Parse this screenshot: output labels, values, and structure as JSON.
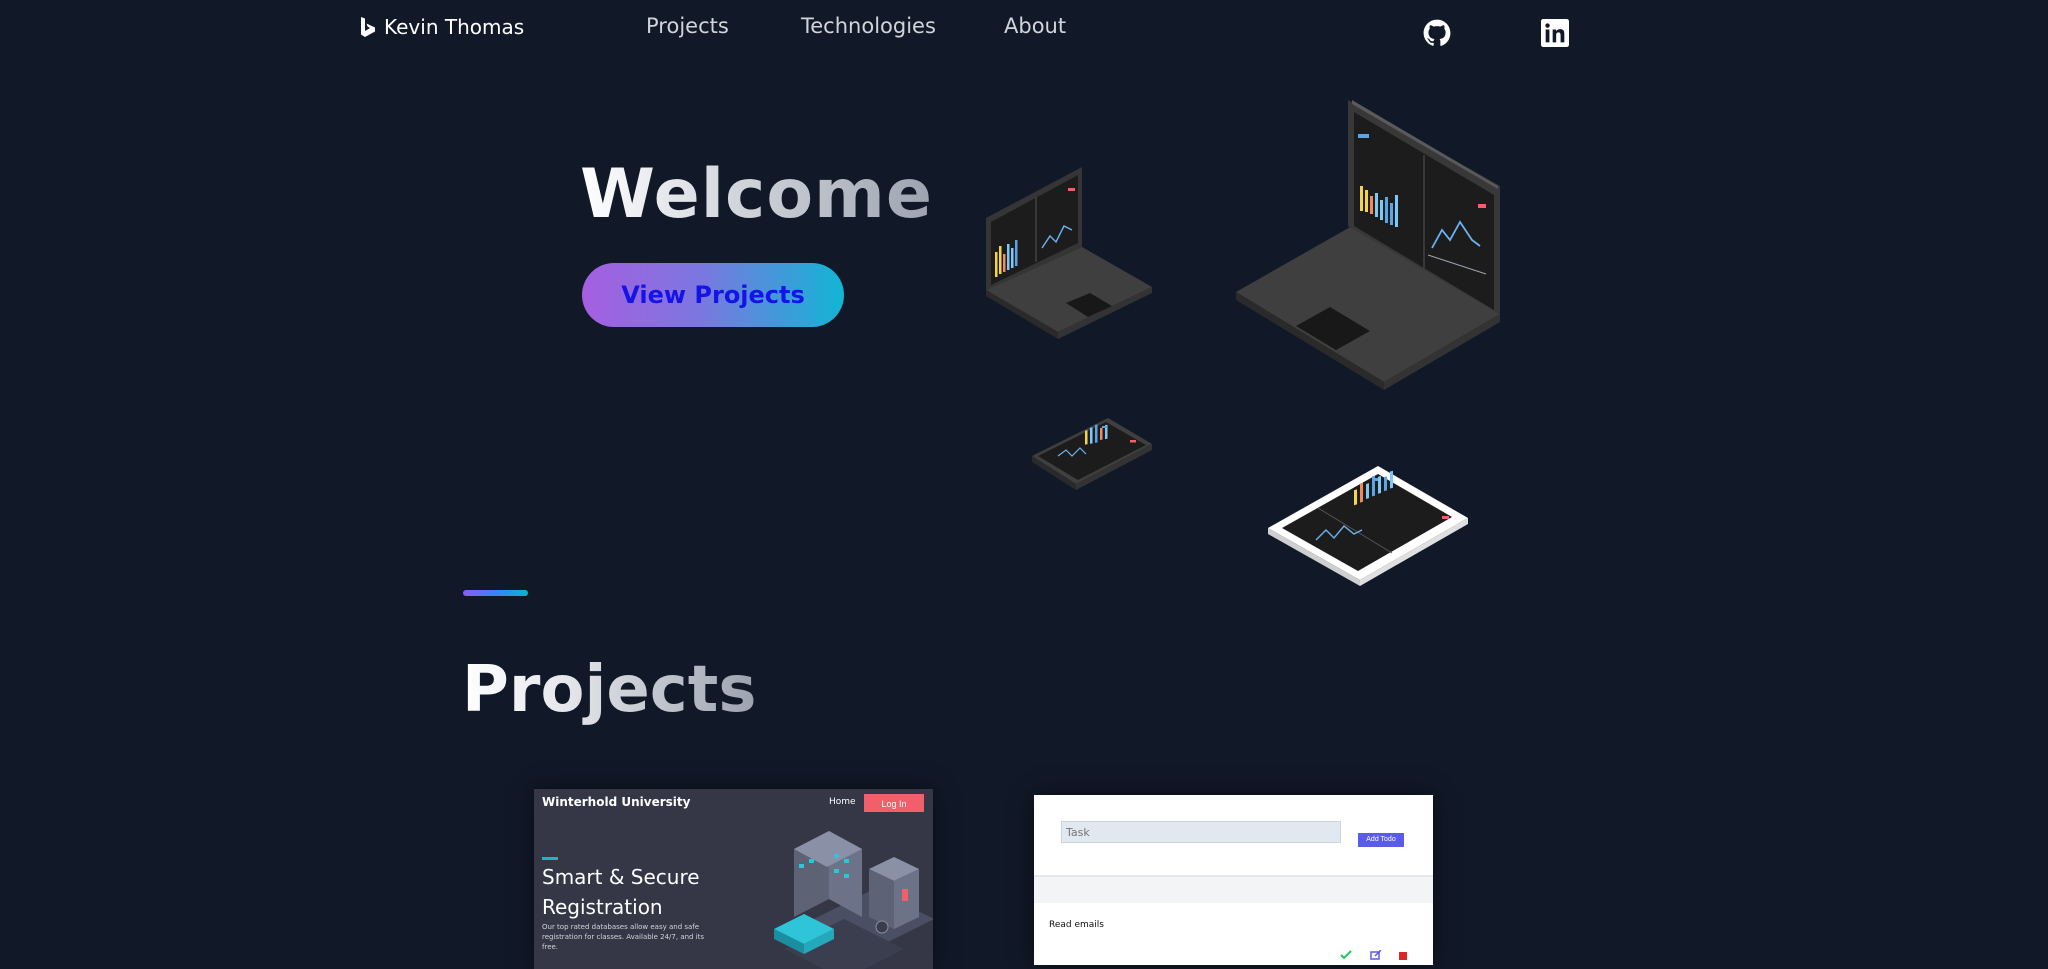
{
  "nav": {
    "brand": "Kevin Thomas",
    "links": [
      "Projects",
      "Technologies",
      "About"
    ]
  },
  "hero": {
    "title": "Welcome",
    "cta_label": "View Projects"
  },
  "projects_section": {
    "title": "Projects"
  },
  "cards": {
    "university": {
      "brand": "Winterhold University",
      "home": "Home",
      "login": "Log In",
      "headline": "Smart & Secure Registration",
      "body": "Our top rated databases allow easy and safe registration for classes. Available 24/7, and its free."
    },
    "todo": {
      "task_placeholder": "Task",
      "add_label": "Add Todo",
      "item": "Read emails"
    }
  },
  "icons": {
    "brand": "bing-logo-icon",
    "github": "github-icon",
    "linkedin": "linkedin-icon"
  },
  "colors": {
    "background": "#111827",
    "cta_gradient_start": "#a55fe0",
    "cta_gradient_end": "#12b5d4",
    "cta_text": "#1414e6"
  }
}
